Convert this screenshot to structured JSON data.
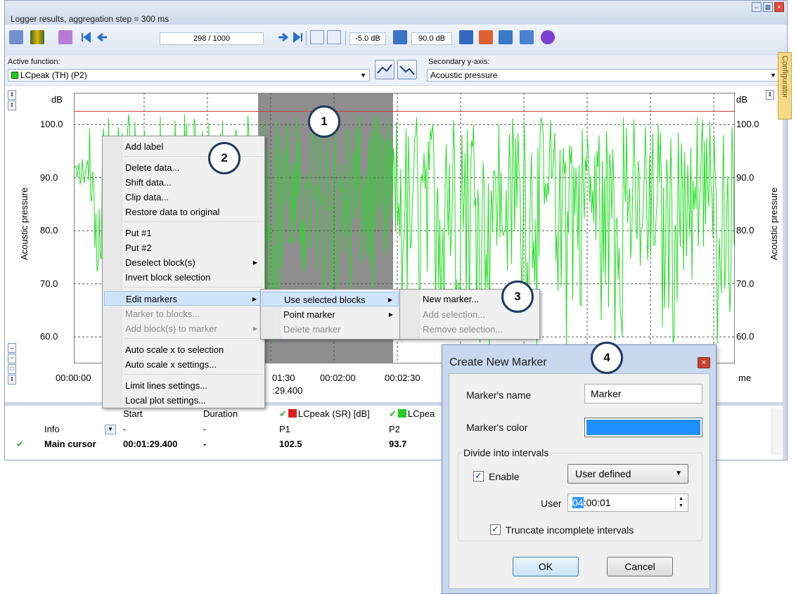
{
  "window": {
    "title": "Logger results, aggregation step = 300 ms"
  },
  "toolbar": {
    "counter": "298 / 1000",
    "min_db": "-5.0 dB",
    "max_db": "90.0 dB"
  },
  "function_row": {
    "active_label": "Active function:",
    "active_value": "LCpeak (TH) (P2)",
    "active_color": "#22cc22",
    "secondary_label": "Secondary y-axis:",
    "secondary_value": "Acoustic pressure"
  },
  "configurator_tab": "Configurator",
  "plot": {
    "unit_left": "dB",
    "unit_right": "dB",
    "ylabel_left": "Acoustic pressure",
    "ylabel_right": "Acoustic pressure",
    "yticks": [
      "100.0",
      "90.0",
      "80.0",
      "70.0",
      "60.0"
    ],
    "xticks": [
      "00:00:00",
      "01:30",
      "00:02:00",
      "00:02:30",
      "me"
    ],
    "cursor_time": ":29.400",
    "series_color": "#22dd22",
    "limit_line_color": "#d03030",
    "selection_color": "#8e8e8e"
  },
  "chart_data": {
    "type": "line",
    "ylim": [
      55,
      106
    ],
    "limit_line": 102.5,
    "series": [
      {
        "name": "LCpeak (TH) (P2)"
      }
    ]
  },
  "table": {
    "headers": {
      "start": "Start",
      "duration": "Duration",
      "col1": "LCpeak (SR) [dB]",
      "col2": "LCpea"
    },
    "rows": [
      {
        "name": "Info",
        "start": "-",
        "duration": "-",
        "v1": "P1",
        "v2": "P2"
      },
      {
        "name": "Main cursor",
        "start": "00:01:29.400",
        "duration": "-",
        "v1": "102.5",
        "v2": "93.7"
      }
    ]
  },
  "context_menu": {
    "items": [
      "Add label",
      "Delete data...",
      "Shift data...",
      "Clip data...",
      "Restore data to original",
      "Put #1",
      "Put #2",
      "Deselect block(s)",
      "Invert block selection",
      "Edit markers",
      "Marker to blocks...",
      "Add block(s) to marker",
      "Auto scale x to selection",
      "Auto scale x settings...",
      "Limit lines settings...",
      "Local plot settings..."
    ]
  },
  "submenu1": {
    "items": [
      "Use selected blocks",
      "Point marker",
      "Delete marker"
    ]
  },
  "submenu2": {
    "items": [
      "New marker...",
      "Add selection...",
      "Remove selection..."
    ]
  },
  "badges": [
    "1",
    "2",
    "3",
    "4"
  ],
  "dialog": {
    "title": "Create New Marker",
    "name_label": "Marker's name",
    "name_value": "Marker",
    "color_label": "Marker's color",
    "color_value": "#1e90ff",
    "group_label": "Divide into intervals",
    "enable_label": "Enable",
    "mode_value": "User defined",
    "user_label": "User",
    "user_hours": "04",
    "user_rest": ":00:01",
    "truncate_label": "Truncate incomplete intervals",
    "ok_label": "OK",
    "cancel_label": "Cancel"
  }
}
